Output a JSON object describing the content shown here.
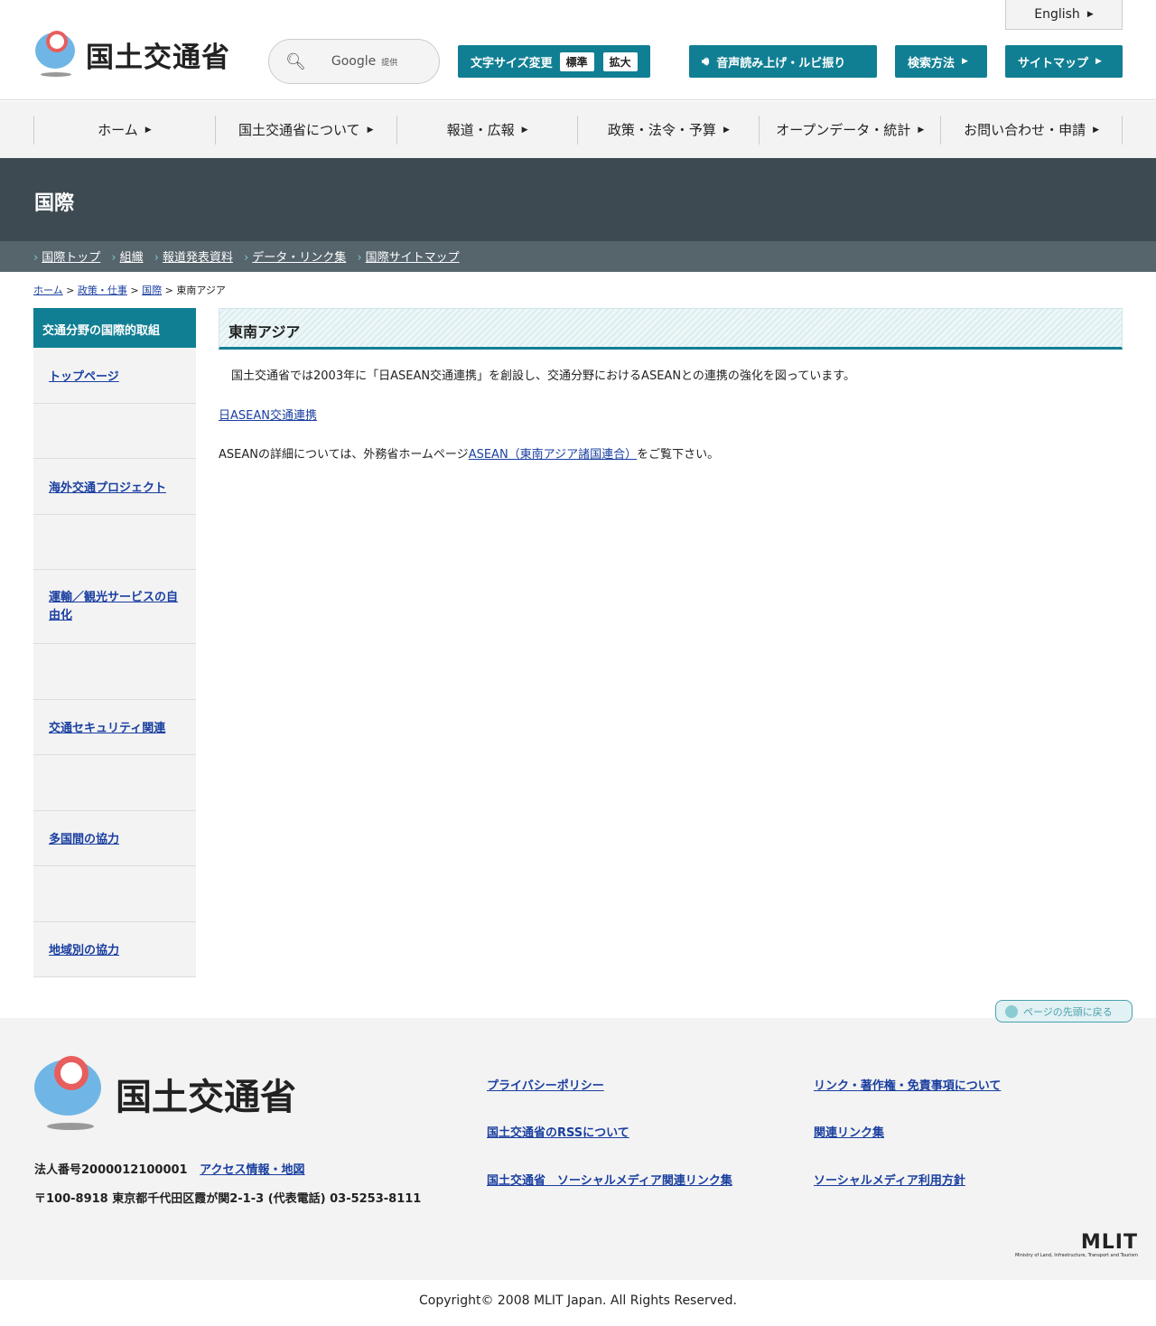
{
  "header": {
    "logo_text": "国土交通省",
    "search_provider": "Google",
    "search_provided": "提供",
    "english": "English",
    "font_size": {
      "label": "文字サイズ変更",
      "standard": "標準",
      "large": "拡大"
    },
    "speech": "音声読み上げ・ルビ振り",
    "search_method": "検索方法",
    "sitemap": "サイトマップ"
  },
  "gnav": [
    "ホーム",
    "国土交通省について",
    "報道・広報",
    "政策・法令・予算",
    "オープンデータ・統計",
    "お問い合わせ・申請"
  ],
  "band_title": "国際",
  "subnav": [
    "国際トップ",
    "組織",
    "報道発表資料",
    "データ・リンク集",
    "国際サイトマップ"
  ],
  "breadcrumb": {
    "items": [
      "ホーム",
      "政策・仕事",
      "国際"
    ],
    "current": "東南アジア",
    "sep": ">"
  },
  "sidebar": {
    "title": "交通分野の国際的取組",
    "items": [
      "トップページ",
      "",
      "海外交通プロジェクト",
      "",
      "運輸／観光サービスの自由化",
      "",
      "交通セキュリティ関連",
      "",
      "多国間の協力",
      "",
      "地域別の協力"
    ]
  },
  "main": {
    "title": "東南アジア",
    "intro": "国土交通省では2003年に「日ASEAN交通連携」を創設し、交通分野におけるASEANとの連携の強化を図っています。",
    "link1": "日ASEAN交通連携",
    "detail_pre": "ASEANの詳細については、外務省ホームページ",
    "detail_link": "ASEAN（東南アジア諸国連合）",
    "detail_post": "をご覧下さい。"
  },
  "to_top": "ページの先頭に戻る",
  "footer": {
    "logo_text": "国土交通省",
    "corp_no": "法人番号2000012100001",
    "access": "アクセス情報・地図",
    "address": "〒100-8918 東京都千代田区霞が関2-1-3 (代表電話) 03-5253-8111",
    "links": [
      "プライバシーポリシー",
      "リンク・著作権・免責事項について",
      "国土交通省のRSSについて",
      "関連リンク集",
      "国土交通省　ソーシャルメディア関連リンク集",
      "ソーシャルメディア利用方針"
    ],
    "mlit": "MLIT",
    "mlit_sub": "Ministry of Land, Infrastructure, Transport and Tourism",
    "copyright": "Copyright© 2008 MLIT Japan. All Rights Reserved."
  }
}
